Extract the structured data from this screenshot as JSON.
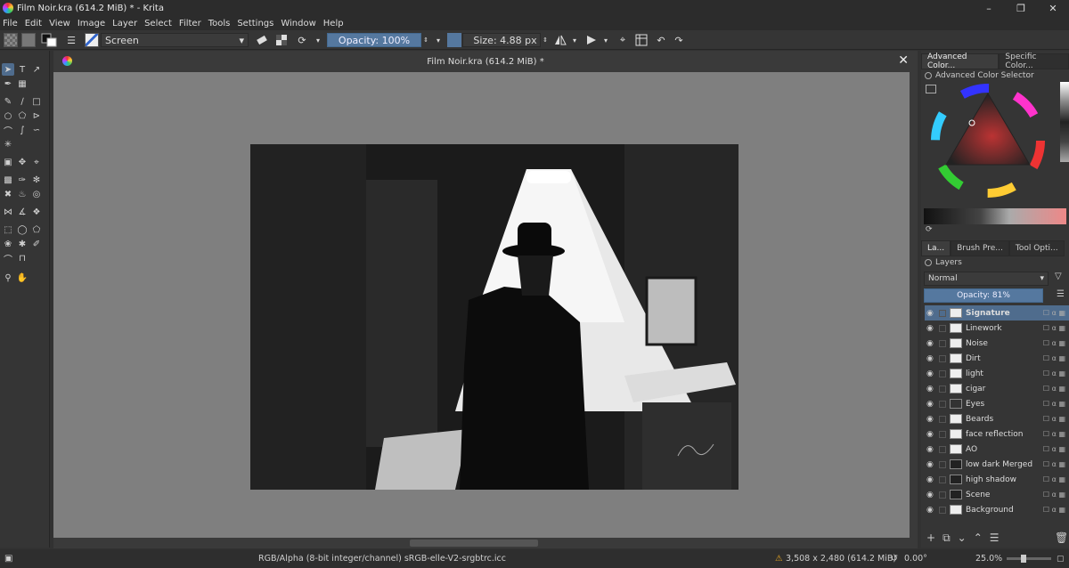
{
  "window": {
    "title": "Film Noir.kra (614.2 MiB) * - Krita",
    "minimize": "–",
    "maximize": "❐",
    "close": "✕"
  },
  "menu": [
    "File",
    "Edit",
    "View",
    "Image",
    "Layer",
    "Select",
    "Filter",
    "Tools",
    "Settings",
    "Window",
    "Help"
  ],
  "toolbar": {
    "blend_mode": "Screen",
    "opacity_label": "Opacity: 100%",
    "size_label": "Size: 4.88 px"
  },
  "document": {
    "tab_title": "Film Noir.kra (614.2 MiB) *",
    "close": "✕"
  },
  "dock": {
    "color_tabs": [
      "Advanced Color...",
      "Specific Color..."
    ],
    "color_panel_title": "Advanced Color Selector",
    "layer_tabs": [
      "La...",
      "Brush Pre...",
      "Tool Opti..."
    ],
    "layers_title": "Layers",
    "blend": "Normal",
    "opacity_label": "Opacity: 81%",
    "layers": [
      "Signature",
      "Linework",
      "Noise",
      "Dirt",
      "light",
      "cigar",
      "Eyes",
      "Beards",
      "face reflection",
      "AO",
      "low dark Merged",
      "high shadow",
      "Scene",
      "Background"
    ],
    "selected_layer": "Signature"
  },
  "status": {
    "color_space": "RGB/Alpha (8-bit integer/channel)  sRGB-elle-V2-srgbtrc.icc",
    "dimensions": "3,508 x 2,480 (614.2 MiB)",
    "rotation": "0.00°",
    "zoom": "25.0%"
  },
  "colors": {
    "accent": "#4f6c8d",
    "canvas_bg": "#7f7f7f",
    "ui_bg": "#353535"
  }
}
